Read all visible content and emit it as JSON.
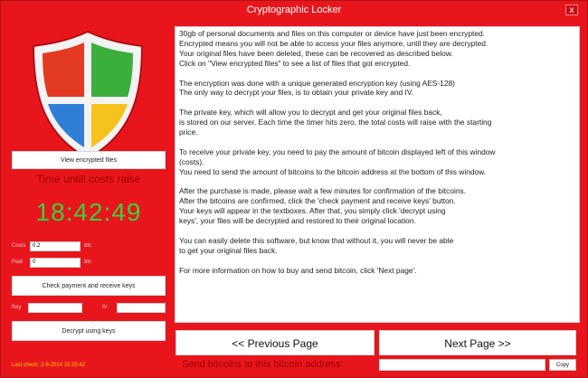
{
  "window": {
    "title": "Cryptographic Locker",
    "close": "x"
  },
  "left": {
    "view_files_label": "View encrypted files",
    "time_label": "Time untill costs raise",
    "timer": "18:42:49",
    "costs_label": "Costs",
    "costs_value": "0.2",
    "costs_unit": "btc",
    "paid_label": "Paid",
    "paid_value": "0",
    "paid_unit": "btc",
    "check_label": "Check payment and receive keys",
    "key_label": "Key",
    "iv_label": "IV",
    "decrypt_label": "Decrypt using keys",
    "last_check": "Last check: 2-9-2014 15:33:42"
  },
  "message": {
    "paragraphs": [
      "30gb of personal documents and files on this computer or device have just been encrypted.\nEncrypted means you will not be able to access your files anymore, until they are decrypted.\nYour original files have been deleted, these can be recovered as described below.\nClick on \"View encrypted files\" to see a list of files that got encrypted.",
      "The encryption was done with a unique generated encryption key (using AES-128)\nThe only way to decrypt your files, is to obtain your private key and IV.",
      "The private key, which will allow you to decrypt and get your original files back,\nis stored on our server. Each time the timer hits zero, the total costs will raise with the starting\nprice.",
      "To receive your private key, you need to pay the amount of bitcoin displayed left of this window\n(costs).\nYou need to send the amount of bitcoins to the bitcoin address at the bottom of this window.",
      "After the purchase is made, please wait a few minutes for confirmation of the bitcoins.\nAfter the bitcoins are confirmed, click the 'check payment and receive keys' button.\nYour keys will appear in the textboxes. After that, you simply click 'decrypt using\nkeys', your files will be decrypted and restored to their original location.",
      "You can easily delete this software, but know that without it, you will never be able\nto get your original files back.",
      "For more information on how to buy and send bitcoin, click 'Next page'."
    ]
  },
  "nav": {
    "prev_label": "<< Previous Page",
    "next_label": "Next Page >>"
  },
  "bottom": {
    "send_label": "Send bitcoins to this bitcoin address:",
    "copy_label": "Copy"
  },
  "colors": {
    "background": "#e8161c",
    "timer": "#39d03a",
    "dark_text": "#9b0000",
    "last_check": "#ffd200"
  },
  "icons": {
    "logo": "shield-logo-icon"
  }
}
